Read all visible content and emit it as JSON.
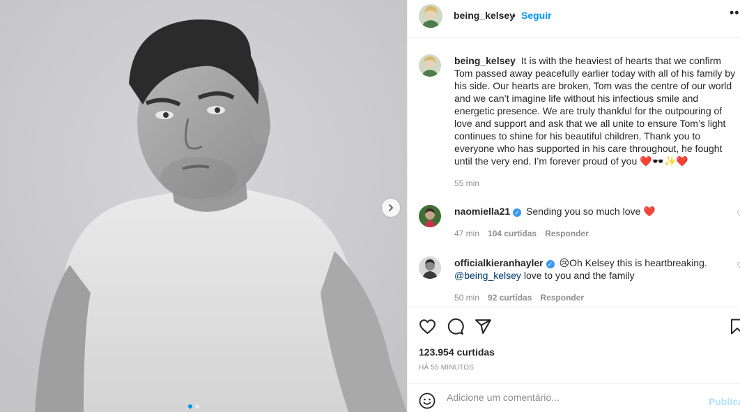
{
  "post": {
    "author": "being_kelsey",
    "follow_label": "Seguir",
    "more_label": "•••",
    "separator": "•"
  },
  "caption": {
    "username": "being_kelsey",
    "text": "It is with the heaviest of hearts that we confirm Tom passed away peacefully earlier today with all of his family by his side. Our hearts are broken, Tom was the centre of our world and we can’t imagine life without his infectious smile and energetic presence. We are truly thankful for the outpouring of love and support and ask that we all unite to ensure Tom’s light continues to shine for his beautiful children. Thank you to everyone who has supported in his care throughout, he fought until the very end. I’m forever proud of you ❤️🕶️✨❤️",
    "time": "55 min"
  },
  "comments": [
    {
      "username": "naomiella21",
      "verified_icon": "verified-badge-icon",
      "text": "Sending you so much love ❤️",
      "time": "47 min",
      "likes": "104 curtidas",
      "reply": "Responder"
    },
    {
      "username": "officialkieranhayler",
      "verified_icon": "verified-badge-icon",
      "text": "😢Oh Kelsey this is heartbreaking.",
      "mention": "@being_kelsey",
      "text_after_mention": "love to you and the family",
      "time": "50 min",
      "likes": "92 curtidas",
      "reply": "Responder"
    }
  ],
  "actions": {
    "icons": [
      "heart-icon",
      "comment-icon",
      "share-icon",
      "bookmark-icon"
    ],
    "likes_count": "123.954 curtidas",
    "posted_ago": "HÁ 55 MINUTOS"
  },
  "composer": {
    "placeholder": "Adicione um comentário...",
    "publish_label": "Publicar",
    "emoji_icon": "emoji-icon"
  },
  "carousel": {
    "total_slides": 2,
    "current_slide": 1,
    "next_icon": "chevron-right-icon"
  },
  "colors": {
    "link_blue": "#0095f6",
    "verified_blue": "#3897f0",
    "muted": "#8e8e8e",
    "border": "#efefef",
    "heart_red": "#ed4956"
  }
}
